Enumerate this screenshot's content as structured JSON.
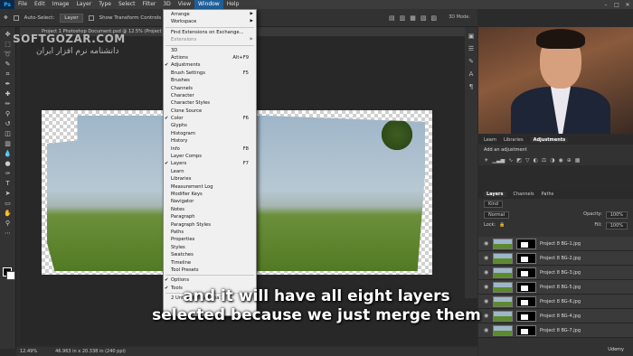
{
  "app": {
    "logo": "Ps"
  },
  "menubar": {
    "items": [
      "File",
      "Edit",
      "Image",
      "Layer",
      "Type",
      "Select",
      "Filter",
      "3D",
      "View",
      "Window",
      "Help"
    ],
    "active": "Window"
  },
  "window_controls": [
    "–",
    "□",
    "✕"
  ],
  "options_bar": {
    "auto_select_label": "Auto-Select:",
    "auto_select_value": "Layer",
    "transform_label": "Show Transform Controls",
    "mode_3d": "3D Mode:"
  },
  "document_tab": {
    "title": "Project 1 Photoshop Document.psd @ 12.5% (Project 8_RGB/8*) ×"
  },
  "watermark": {
    "text": "SOFTGOZAR.COM",
    "subtext": "دانشنامه نرم افزار ایران"
  },
  "window_menu": {
    "items": [
      {
        "label": "Arrange",
        "submenu": true,
        "shortcut": "",
        "checked": false,
        "disabled": false
      },
      {
        "label": "Workspace",
        "submenu": true,
        "shortcut": "",
        "checked": false,
        "disabled": false
      },
      {
        "sep": true
      },
      {
        "label": "Find Extensions on Exchange...",
        "submenu": false,
        "shortcut": "",
        "checked": false,
        "disabled": false
      },
      {
        "label": "Extensions",
        "submenu": true,
        "shortcut": "",
        "checked": false,
        "disabled": true
      },
      {
        "sep": true
      },
      {
        "label": "3D",
        "submenu": false,
        "shortcut": "",
        "checked": false,
        "disabled": false
      },
      {
        "label": "Actions",
        "submenu": false,
        "shortcut": "Alt+F9",
        "checked": false,
        "disabled": false
      },
      {
        "label": "Adjustments",
        "submenu": false,
        "shortcut": "",
        "checked": true,
        "disabled": false
      },
      {
        "label": "Brush Settings",
        "submenu": false,
        "shortcut": "F5",
        "checked": false,
        "disabled": false
      },
      {
        "label": "Brushes",
        "submenu": false,
        "shortcut": "",
        "checked": false,
        "disabled": false
      },
      {
        "label": "Channels",
        "submenu": false,
        "shortcut": "",
        "checked": false,
        "disabled": false
      },
      {
        "label": "Character",
        "submenu": false,
        "shortcut": "",
        "checked": false,
        "disabled": false
      },
      {
        "label": "Character Styles",
        "submenu": false,
        "shortcut": "",
        "checked": false,
        "disabled": false
      },
      {
        "label": "Clone Source",
        "submenu": false,
        "shortcut": "",
        "checked": false,
        "disabled": false
      },
      {
        "label": "Color",
        "submenu": false,
        "shortcut": "F6",
        "checked": true,
        "disabled": false
      },
      {
        "label": "Glyphs",
        "submenu": false,
        "shortcut": "",
        "checked": false,
        "disabled": false
      },
      {
        "label": "Histogram",
        "submenu": false,
        "shortcut": "",
        "checked": false,
        "disabled": false
      },
      {
        "label": "History",
        "submenu": false,
        "shortcut": "",
        "checked": false,
        "disabled": false
      },
      {
        "label": "Info",
        "submenu": false,
        "shortcut": "F8",
        "checked": false,
        "disabled": false
      },
      {
        "label": "Layer Comps",
        "submenu": false,
        "shortcut": "",
        "checked": false,
        "disabled": false
      },
      {
        "label": "Layers",
        "submenu": false,
        "shortcut": "F7",
        "checked": true,
        "disabled": false
      },
      {
        "label": "Learn",
        "submenu": false,
        "shortcut": "",
        "checked": false,
        "disabled": false
      },
      {
        "label": "Libraries",
        "submenu": false,
        "shortcut": "",
        "checked": false,
        "disabled": false
      },
      {
        "label": "Measurement Log",
        "submenu": false,
        "shortcut": "",
        "checked": false,
        "disabled": false
      },
      {
        "label": "Modifier Keys",
        "submenu": false,
        "shortcut": "",
        "checked": false,
        "disabled": false
      },
      {
        "label": "Navigator",
        "submenu": false,
        "shortcut": "",
        "checked": false,
        "disabled": false
      },
      {
        "label": "Notes",
        "submenu": false,
        "shortcut": "",
        "checked": false,
        "disabled": false
      },
      {
        "label": "Paragraph",
        "submenu": false,
        "shortcut": "",
        "checked": false,
        "disabled": false
      },
      {
        "label": "Paragraph Styles",
        "submenu": false,
        "shortcut": "",
        "checked": false,
        "disabled": false
      },
      {
        "label": "Paths",
        "submenu": false,
        "shortcut": "",
        "checked": false,
        "disabled": false
      },
      {
        "label": "Properties",
        "submenu": false,
        "shortcut": "",
        "checked": false,
        "disabled": false
      },
      {
        "label": "Styles",
        "submenu": false,
        "shortcut": "",
        "checked": false,
        "disabled": false
      },
      {
        "label": "Swatches",
        "submenu": false,
        "shortcut": "",
        "checked": false,
        "disabled": false
      },
      {
        "label": "Timeline",
        "submenu": false,
        "shortcut": "",
        "checked": false,
        "disabled": false
      },
      {
        "label": "Tool Presets",
        "submenu": false,
        "shortcut": "",
        "checked": false,
        "disabled": false
      },
      {
        "sep": true
      },
      {
        "label": "Options",
        "submenu": false,
        "shortcut": "",
        "checked": true,
        "disabled": false
      },
      {
        "label": "Tools",
        "submenu": false,
        "shortcut": "",
        "checked": true,
        "disabled": false
      },
      {
        "sep": true
      },
      {
        "label": "2 Untitled-Panorama 1",
        "submenu": false,
        "shortcut": "",
        "checked": false,
        "disabled": false
      }
    ]
  },
  "status_bar": {
    "zoom": "12.49%",
    "doc_size": "46.963 in x 20.338 in (240 ppi)"
  },
  "panels": {
    "top_tabs": [
      "Learn",
      "Libraries",
      "Adjustments"
    ],
    "active_top_tab": "Adjustments",
    "adjustments_title": "Add an adjustment",
    "layer_tabs": [
      "Layers",
      "Channels",
      "Paths"
    ],
    "active_layer_tab": "Layers",
    "kind_label": "Kind",
    "blend_mode": "Normal",
    "opacity_label": "Opacity:",
    "opacity_value": "100%",
    "lock_label": "Lock:",
    "fill_label": "Fill:",
    "fill_value": "100%",
    "layers": [
      "Project 8 BG-1.jpg",
      "Project 8 BG-2.jpg",
      "Project 8 BG-3.jpg",
      "Project 8 BG-5.jpg",
      "Project 8 BG-6.jpg",
      "Project 8 BG-4.jpg",
      "Project 8 BG-7.jpg"
    ]
  },
  "caption": {
    "line1": "and it will have all eight layers",
    "line2": "selected because we just merge them"
  },
  "branding": {
    "udemy": "Udemy"
  },
  "colors": {
    "menu_active": "#1f5f99",
    "photoshop_blue": "#31a8ff"
  }
}
